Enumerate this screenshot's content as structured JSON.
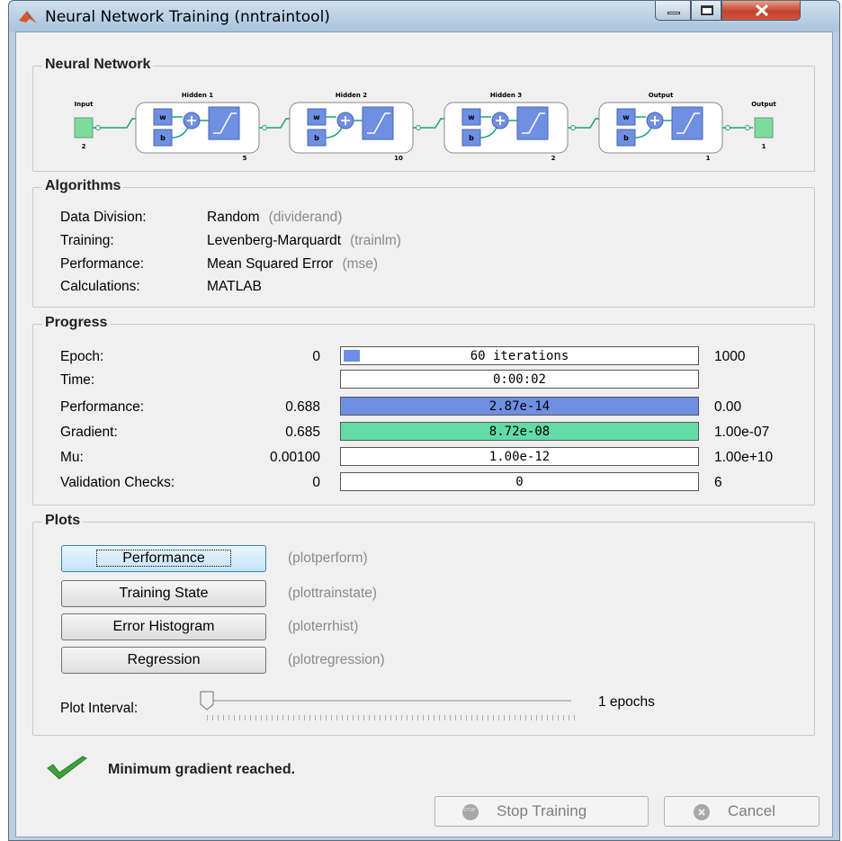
{
  "window": {
    "title": "Neural Network Training (nntraintool)"
  },
  "network": {
    "group_title": "Neural Network",
    "input": {
      "label": "Input",
      "size": "2"
    },
    "layers": [
      {
        "label": "Hidden 1",
        "size": "5"
      },
      {
        "label": "Hidden 2",
        "size": "10"
      },
      {
        "label": "Hidden 3",
        "size": "2"
      },
      {
        "label": "Output",
        "size": "1"
      }
    ],
    "output": {
      "label": "Output",
      "size": "1"
    },
    "weight_label": "w",
    "bias_label": "b"
  },
  "algorithms": {
    "group_title": "Algorithms",
    "rows": [
      {
        "key": "Data Division:",
        "value": "Random",
        "fn": "(dividerand)"
      },
      {
        "key": "Training:",
        "value": "Levenberg-Marquardt",
        "fn": "(trainlm)"
      },
      {
        "key": "Performance:",
        "value": "Mean Squared Error",
        "fn": "(mse)"
      },
      {
        "key": "Calculations:",
        "value": "MATLAB",
        "fn": ""
      }
    ]
  },
  "progress": {
    "group_title": "Progress",
    "rows": [
      {
        "name": "Epoch:",
        "start": "0",
        "current": "60 iterations",
        "end": "1000",
        "fill_fraction": 0.06,
        "fill_color": "#6b8ee8"
      },
      {
        "name": "Time:",
        "start": "",
        "current": "0:00:02",
        "end": "",
        "fill_fraction": 0,
        "fill_color": ""
      },
      {
        "name": "Performance:",
        "start": "0.688",
        "current": "2.87e-14",
        "end": "0.00",
        "fill_fraction": 1.0,
        "fill_color": "#6f8fe3"
      },
      {
        "name": "Gradient:",
        "start": "0.685",
        "current": "8.72e-08",
        "end": "1.00e-07",
        "fill_fraction": 1.0,
        "fill_color": "#63dba6"
      },
      {
        "name": "Mu:",
        "start": "0.00100",
        "current": "1.00e-12",
        "end": "1.00e+10",
        "fill_fraction": 0,
        "fill_color": ""
      },
      {
        "name": "Validation Checks:",
        "start": "0",
        "current": "0",
        "end": "6",
        "fill_fraction": 0,
        "fill_color": ""
      }
    ]
  },
  "plots": {
    "group_title": "Plots",
    "buttons": [
      {
        "label": "Performance",
        "fn": "(plotperform)"
      },
      {
        "label": "Training State",
        "fn": "(plottrainstate)"
      },
      {
        "label": "Error Histogram",
        "fn": "(ploterrhist)"
      },
      {
        "label": "Regression",
        "fn": "(plotregression)"
      }
    ],
    "interval_label": "Plot Interval:",
    "interval_value": "1 epochs",
    "interval_fraction": 0.0
  },
  "status": {
    "message": "Minimum gradient reached.",
    "icon": "check-icon",
    "color": "#3aa23a"
  },
  "actions": {
    "stop_label": "Stop Training",
    "stop_icon_text": "STOP",
    "cancel_label": "Cancel"
  }
}
